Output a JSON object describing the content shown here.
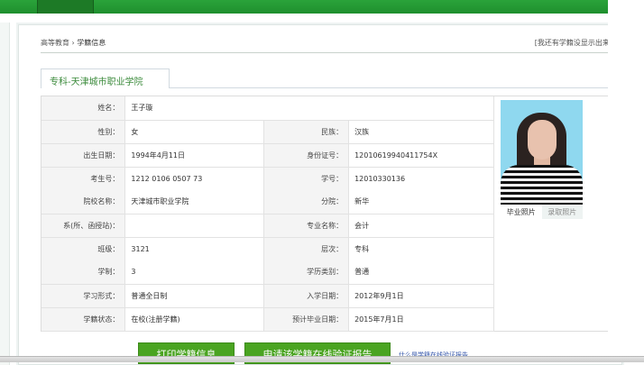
{
  "breadcrumb": {
    "home": "高等教育",
    "separator": "›",
    "current": "学籍信息"
  },
  "not_shown_link": "[我还有学籍没显示出来]",
  "tab_label": "专科-天津城市职业学院",
  "rows": [
    {
      "l1": "姓名：",
      "v1": "王子璇"
    },
    {
      "l1": "性别：",
      "v1": "女",
      "l2": "民族：",
      "v2": "汉族"
    },
    {
      "l1": "出生日期：",
      "v1": "1994年4月11日",
      "l2": "身份证号：",
      "v2": "12010619940411754X"
    },
    {
      "l1": "考生号：",
      "v1": "1212 0106 0507 73",
      "l2": "学号：",
      "v2": "12010330136"
    },
    {
      "l1": "院校名称：",
      "v1": "天津城市职业学院",
      "l2": "分院：",
      "v2": "新华"
    },
    {
      "l1": "系(所、函授站)：",
      "v1": "",
      "l2": "专业名称：",
      "v2": "会计"
    },
    {
      "l1": "班级：",
      "v1": "3121",
      "l2": "层次：",
      "v2": "专科"
    },
    {
      "l1": "学制：",
      "v1": "3",
      "l2": "学历类别：",
      "v2": "普通"
    },
    {
      "l1": "学习形式：",
      "v1": "普通全日制",
      "l2": "入学日期：",
      "v2": "2012年9月1日"
    },
    {
      "l1": "学籍状态：",
      "v1": "在校(注册学籍)",
      "l2": "预计毕业日期：",
      "v2": "2015年7月1日"
    }
  ],
  "photo_tabs": {
    "graduation": "毕业照片",
    "admission": "录取照片"
  },
  "buttons": {
    "print": "打印学籍信息",
    "apply": "申请该学籍在线验证报告"
  },
  "link": "什么是学籍在线验证报告",
  "colors": {
    "brand_green": "#2aa33a",
    "button_green": "#4aa421"
  }
}
